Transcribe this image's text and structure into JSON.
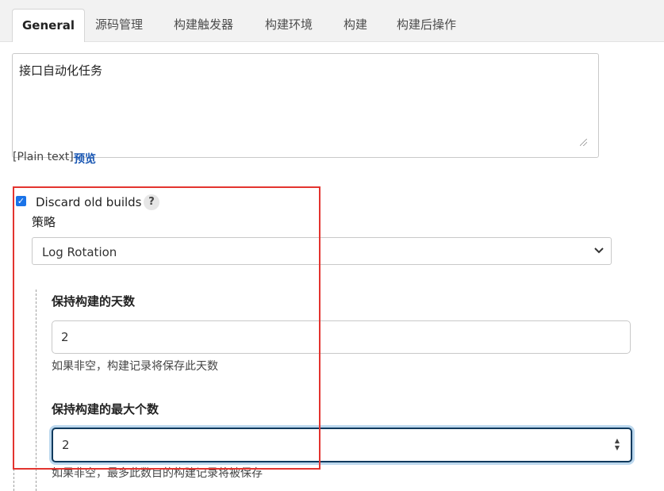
{
  "tabs": [
    {
      "label": "General",
      "active": true
    },
    {
      "label": "源码管理",
      "active": false
    },
    {
      "label": "构建触发器",
      "active": false
    },
    {
      "label": "构建环境",
      "active": false
    },
    {
      "label": "构建",
      "active": false
    },
    {
      "label": "构建后操作",
      "active": false
    }
  ],
  "description": {
    "value": "接口自动化任务",
    "markup_note": "[Plain text]",
    "preview_label": "预览"
  },
  "discard_old_builds": {
    "label": "Discard old builds",
    "checked": true,
    "help_icon": "?",
    "strategy_label": "策略",
    "strategy_value": "Log Rotation",
    "days_to_keep": {
      "label": "保持构建的天数",
      "value": "2",
      "hint": "如果非空，构建记录将保存此天数"
    },
    "max_builds": {
      "label": "保持构建的最大个数",
      "value": "2",
      "hint": "如果非空，最多此数目的构建记录将被保存"
    }
  },
  "colors": {
    "accent_blue": "#1a73e8",
    "link_blue": "#1a57b3",
    "highlight_red": "#e3342f",
    "focus_border": "#103a5e"
  }
}
